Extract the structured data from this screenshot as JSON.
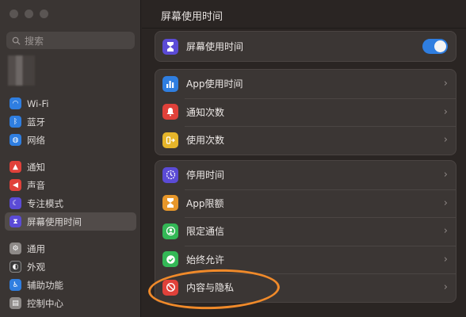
{
  "sidebar": {
    "search_placeholder": "搜索",
    "groups": [
      [
        {
          "label": "Wi-Fi",
          "icon": "wifi-icon",
          "color": "#2f7ee0"
        },
        {
          "label": "蓝牙",
          "icon": "bluetooth-icon",
          "color": "#2f7ee0"
        },
        {
          "label": "网络",
          "icon": "globe-icon",
          "color": "#2f7ee0"
        }
      ],
      [
        {
          "label": "通知",
          "icon": "bell-icon",
          "color": "#e0413a"
        },
        {
          "label": "声音",
          "icon": "speaker-icon",
          "color": "#e0413a"
        },
        {
          "label": "专注模式",
          "icon": "moon-icon",
          "color": "#5b4bd6"
        },
        {
          "label": "屏幕使用时间",
          "icon": "hourglass-icon",
          "color": "#5b4bd6",
          "active": true
        }
      ],
      [
        {
          "label": "通用",
          "icon": "gear-icon",
          "color": "#8e8a88"
        },
        {
          "label": "外观",
          "icon": "appearance-icon",
          "color": "#3a3a3a"
        },
        {
          "label": "辅助功能",
          "icon": "accessibility-icon",
          "color": "#2f7ee0"
        },
        {
          "label": "控制中心",
          "icon": "control-center-icon",
          "color": "#8e8a88"
        }
      ]
    ]
  },
  "main": {
    "title": "屏幕使用时间",
    "screen_time_toggle": {
      "label": "屏幕使用时间",
      "on": true,
      "icon_color": "#5b4bd6"
    },
    "usage_rows": [
      {
        "label": "App使用时间",
        "icon": "bar-chart-icon",
        "color": "#2f7ee0"
      },
      {
        "label": "通知次数",
        "icon": "bell-badge-icon",
        "color": "#e0413a"
      },
      {
        "label": "使用次数",
        "icon": "pickups-icon",
        "color": "#e6b52a"
      }
    ],
    "limit_rows": [
      {
        "label": "停用时间",
        "icon": "downtime-icon",
        "color": "#5b4bd6"
      },
      {
        "label": "App限额",
        "icon": "hourglass-icon",
        "color": "#e8972a"
      },
      {
        "label": "限定通信",
        "icon": "communication-icon",
        "color": "#33b856"
      },
      {
        "label": "始终允许",
        "icon": "checkmark-icon",
        "color": "#33b856"
      },
      {
        "label": "内容与隐私",
        "icon": "no-sign-icon",
        "color": "#e0413a"
      }
    ]
  },
  "colors": {
    "annotation": "#f08a2a"
  }
}
